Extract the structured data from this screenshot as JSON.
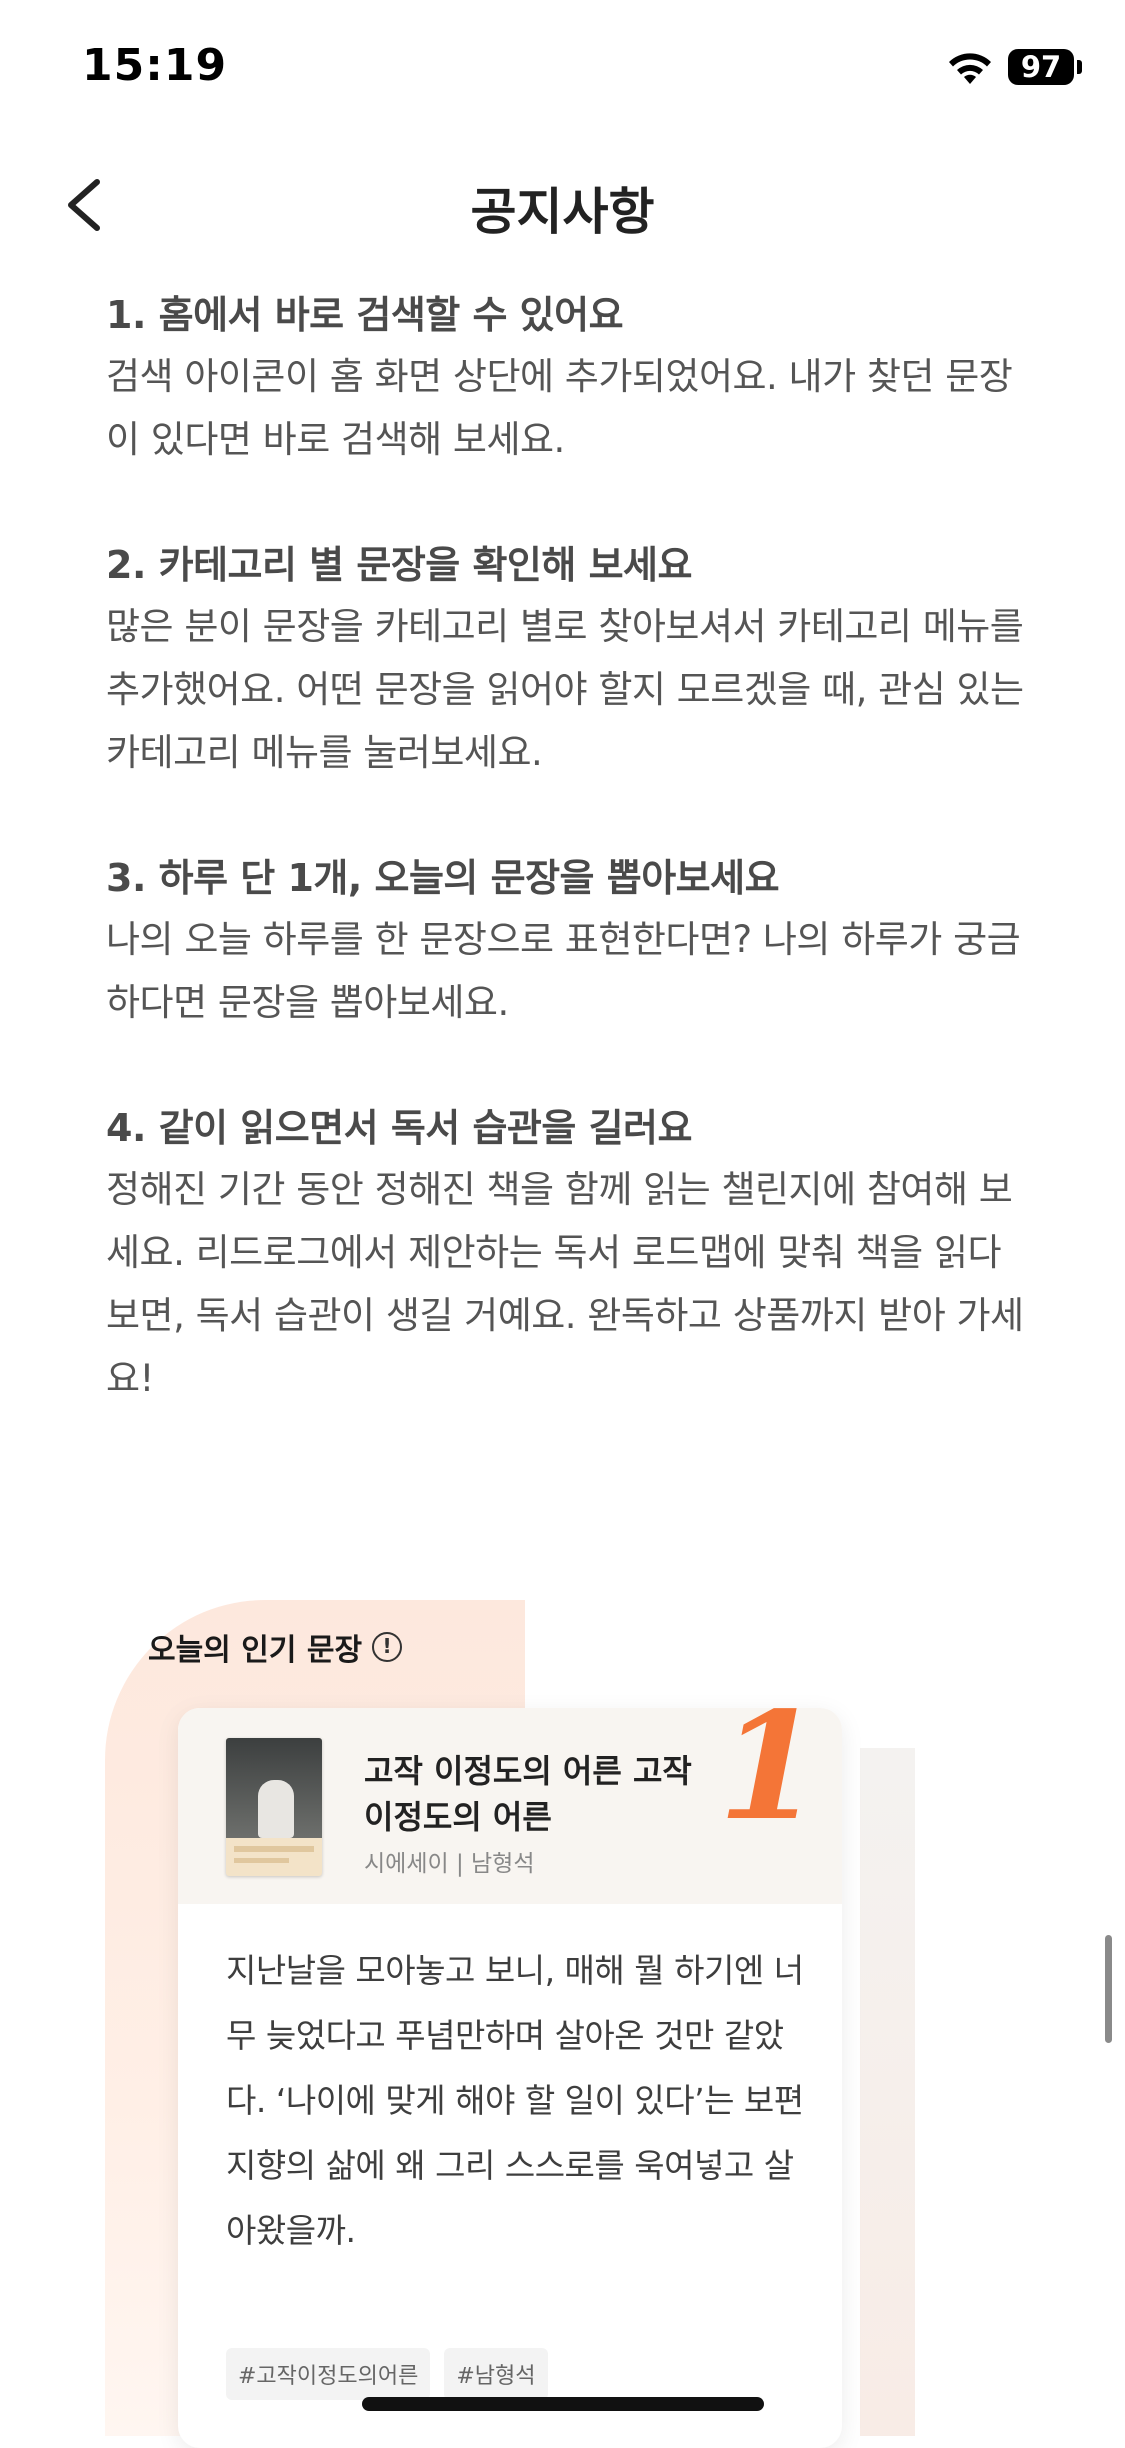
{
  "status_bar": {
    "time": "15:19",
    "battery": "97"
  },
  "nav": {
    "title": "공지사항"
  },
  "notices": [
    {
      "title": "1. 홈에서 바로 검색할 수 있어요",
      "body": "검색 아이콘이 홈 화면 상단에 추가되었어요. 내가 찾던 문장이 있다면 바로 검색해 보세요."
    },
    {
      "title": "2. 카테고리 별 문장을 확인해 보세요",
      "body": "많은 분이 문장을 카테고리 별로 찾아보셔서 카테고리 메뉴를 추가했어요. 어떤 문장을 읽어야 할지 모르겠을 때, 관심 있는 카테고리 메뉴를 눌러보세요."
    },
    {
      "title": "3. 하루 단 1개, 오늘의 문장을 뽑아보세요",
      "body": "나의 오늘 하루를 한 문장으로 표현한다면? 나의 하루가 궁금하다면 문장을 뽑아보세요."
    },
    {
      "title": "4. 같이 읽으면서 독서 습관을 길러요",
      "body": "정해진 기간 동안 정해진 책을 함께 읽는 챌린지에 참여해 보세요. 리드로그에서 제안하는 독서 로드맵에 맞춰 책을 읽다 보면, 독서 습관이 생길 거예요. 완독하고 상품까지 받아 가세요!"
    }
  ],
  "popular": {
    "section_title": "오늘의 인기 문장",
    "info_glyph": "!",
    "card": {
      "rank": "1",
      "book_title": "고작 이정도의 어른 고작 이정도의 어른",
      "book_meta": "시에세이 | 남형석",
      "quote": "지난날을 모아놓고 보니, 매해 뭘 하기엔 너무 늦었다고 푸념만하며 살아온 것만 같았다. ‘나이에 맞게 해야 할 일이 있다’는 보편 지향의 삶에 왜 그리 스스로를 욱여넣고 살아왔을까.",
      "tags": [
        "#고작이정도의어른",
        "#남형석"
      ]
    }
  },
  "colors": {
    "accent": "#f47537",
    "blob": "#fde8dd",
    "card_head": "#f8f5f1"
  },
  "icons": {
    "back": "chevron-left-icon",
    "wifi": "wifi-icon",
    "battery": "battery-icon",
    "info": "info-icon"
  }
}
